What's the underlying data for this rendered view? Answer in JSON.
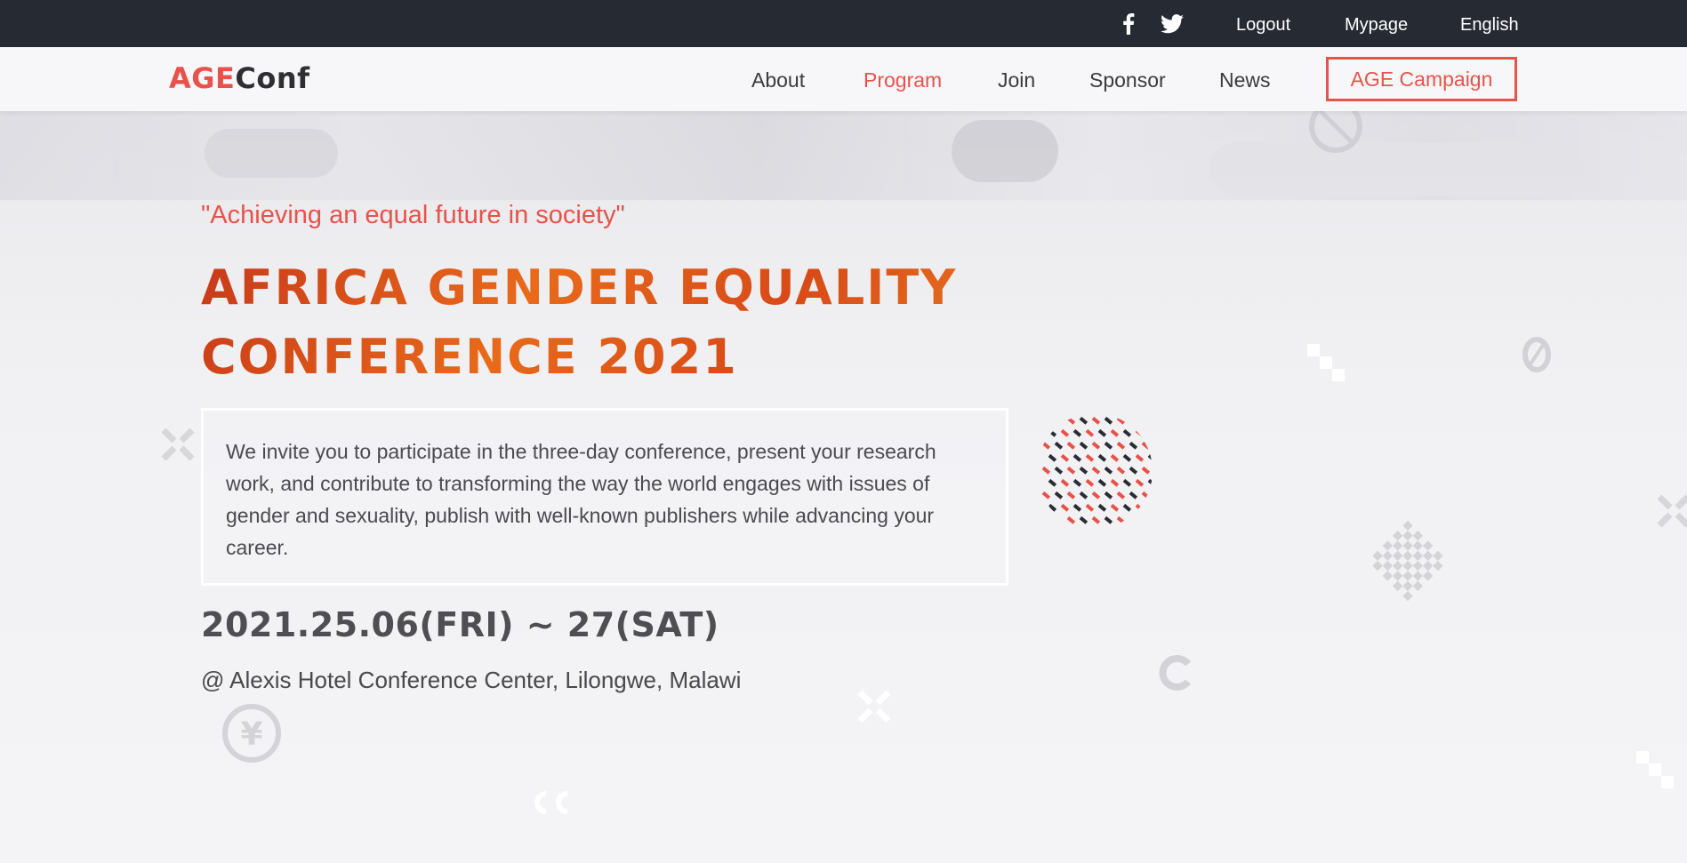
{
  "topbar": {
    "facebook_icon": "facebook-icon",
    "twitter_icon": "twitter-icon",
    "logout": "Logout",
    "mypage": "Mypage",
    "language": "English"
  },
  "nav": {
    "logo_part1": "AGE",
    "logo_part2": "Conf",
    "items": [
      "About",
      "Program",
      "Join",
      "Sponsor",
      "News"
    ],
    "active": "Program",
    "campaign": "AGE Campaign"
  },
  "hero": {
    "tagline": "\"Achieving an equal future in society\"",
    "title_line1": "AFRICA GENDER EQUALITY",
    "title_line2": "CONFERENCE 2021",
    "invite": "We invite you to participate in the three-day conference, present your research work, and contribute to transforming the way the world engages with issues of gender and sexuality, publish with well-known publishers while advancing your career.",
    "date": "2021.25.06(FRI) ~ 27(SAT)",
    "venue": "@ Alexis Hotel Conference Center, Lilongwe, Malawi"
  },
  "colors": {
    "accent": "#e8524a",
    "topbar_bg": "#262a33",
    "title_orange": "#e0621c"
  }
}
